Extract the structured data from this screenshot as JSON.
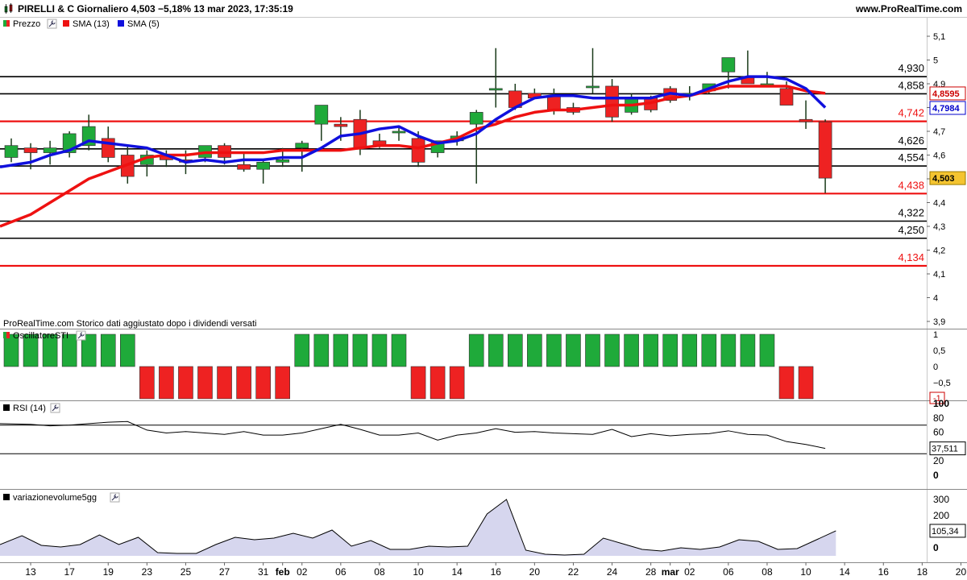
{
  "header": {
    "title": "PIRELLI & C Giornaliero 4,503  −5,18% 13 mar 2023, 17:35:19",
    "watermark": "www.ProRealTime.com"
  },
  "legend": {
    "price": "Prezzo",
    "sma13": "SMA (13)",
    "sma5": "SMA (5)",
    "osc": "OscillatoreSTI",
    "rsi": "RSI (14)",
    "vol": "variazionevolume5gg"
  },
  "note": "ProRealTime.com  Storico dati aggiustato dopo i dividendi versati",
  "colors": {
    "up": "#1faa3a",
    "down": "#ee2222",
    "sma13": "#ee1111",
    "sma5": "#1010dd",
    "level_black": "#000000",
    "level_red": "#ee1111",
    "vol_fill": "#d6d6ee",
    "last_price_bg": "#f4c430"
  },
  "chart_data": [
    {
      "type": "candlestick",
      "panel": "price",
      "y_ticks": [
        "5,1",
        "5",
        "4,9",
        "4,8",
        "4,7",
        "4,6",
        "4,5",
        "4,4",
        "4,3",
        "4,2",
        "4,1",
        "4",
        "3,9"
      ],
      "ylim": [
        3.9,
        5.15
      ],
      "x_tick_labels": [
        {
          "i": 1,
          "t": "13"
        },
        {
          "i": 3,
          "t": "17"
        },
        {
          "i": 5,
          "t": "19"
        },
        {
          "i": 7,
          "t": "23"
        },
        {
          "i": 9,
          "t": "25"
        },
        {
          "i": 11,
          "t": "27"
        },
        {
          "i": 13,
          "t": "31"
        },
        {
          "i": 14,
          "t": "feb"
        },
        {
          "i": 15,
          "t": "02"
        },
        {
          "i": 17,
          "t": "06"
        },
        {
          "i": 19,
          "t": "08"
        },
        {
          "i": 21,
          "t": "10"
        },
        {
          "i": 23,
          "t": "14"
        },
        {
          "i": 25,
          "t": "16"
        },
        {
          "i": 27,
          "t": "20"
        },
        {
          "i": 29,
          "t": "22"
        },
        {
          "i": 31,
          "t": "24"
        },
        {
          "i": 33,
          "t": "28"
        },
        {
          "i": 34,
          "t": "mar"
        },
        {
          "i": 35,
          "t": "02"
        },
        {
          "i": 37,
          "t": "06"
        },
        {
          "i": 39,
          "t": "08"
        },
        {
          "i": 41,
          "t": "10"
        },
        {
          "i": 43,
          "t": "14"
        },
        {
          "i": 45,
          "t": "16"
        },
        {
          "i": 47,
          "t": "18"
        },
        {
          "i": 49,
          "t": "20"
        }
      ],
      "candles": [
        {
          "o": 4.59,
          "h": 4.67,
          "l": 4.57,
          "c": 4.64
        },
        {
          "o": 4.63,
          "h": 4.65,
          "l": 4.54,
          "c": 4.61
        },
        {
          "o": 4.61,
          "h": 4.66,
          "l": 4.56,
          "c": 4.63
        },
        {
          "o": 4.61,
          "h": 4.7,
          "l": 4.59,
          "c": 4.69
        },
        {
          "o": 4.64,
          "h": 4.77,
          "l": 4.62,
          "c": 4.72
        },
        {
          "o": 4.67,
          "h": 4.72,
          "l": 4.57,
          "c": 4.59
        },
        {
          "o": 4.6,
          "h": 4.64,
          "l": 4.48,
          "c": 4.51
        },
        {
          "o": 4.56,
          "h": 4.62,
          "l": 4.51,
          "c": 4.6
        },
        {
          "o": 4.6,
          "h": 4.62,
          "l": 4.55,
          "c": 4.58
        },
        {
          "o": 4.58,
          "h": 4.62,
          "l": 4.52,
          "c": 4.57
        },
        {
          "o": 4.59,
          "h": 4.64,
          "l": 4.57,
          "c": 4.64
        },
        {
          "o": 4.64,
          "h": 4.65,
          "l": 4.56,
          "c": 4.59
        },
        {
          "o": 4.56,
          "h": 4.61,
          "l": 4.53,
          "c": 4.54
        },
        {
          "o": 4.54,
          "h": 4.58,
          "l": 4.48,
          "c": 4.57
        },
        {
          "o": 4.57,
          "h": 4.63,
          "l": 4.55,
          "c": 4.58
        },
        {
          "o": 4.63,
          "h": 4.66,
          "l": 4.53,
          "c": 4.65
        },
        {
          "o": 4.73,
          "h": 4.81,
          "l": 4.66,
          "c": 4.81
        },
        {
          "o": 4.73,
          "h": 4.76,
          "l": 4.66,
          "c": 4.72
        },
        {
          "o": 4.75,
          "h": 4.79,
          "l": 4.6,
          "c": 4.63
        },
        {
          "o": 4.66,
          "h": 4.69,
          "l": 4.63,
          "c": 4.64
        },
        {
          "o": 4.7,
          "h": 4.72,
          "l": 4.66,
          "c": 4.7
        },
        {
          "o": 4.67,
          "h": 4.7,
          "l": 4.55,
          "c": 4.57
        },
        {
          "o": 4.61,
          "h": 4.65,
          "l": 4.59,
          "c": 4.66
        },
        {
          "o": 4.66,
          "h": 4.7,
          "l": 4.64,
          "c": 4.68
        },
        {
          "o": 4.73,
          "h": 4.79,
          "l": 4.48,
          "c": 4.78
        },
        {
          "o": 4.88,
          "h": 5.05,
          "l": 4.8,
          "c": 4.88
        },
        {
          "o": 4.87,
          "h": 4.9,
          "l": 4.79,
          "c": 4.8
        },
        {
          "o": 4.86,
          "h": 4.88,
          "l": 4.84,
          "c": 4.84
        },
        {
          "o": 4.85,
          "h": 4.88,
          "l": 4.77,
          "c": 4.79
        },
        {
          "o": 4.8,
          "h": 4.82,
          "l": 4.77,
          "c": 4.78
        },
        {
          "o": 4.89,
          "h": 5.05,
          "l": 4.86,
          "c": 4.89
        },
        {
          "o": 4.89,
          "h": 4.92,
          "l": 4.74,
          "c": 4.76
        },
        {
          "o": 4.78,
          "h": 4.86,
          "l": 4.77,
          "c": 4.84
        },
        {
          "o": 4.84,
          "h": 4.85,
          "l": 4.78,
          "c": 4.79
        },
        {
          "o": 4.88,
          "h": 4.89,
          "l": 4.82,
          "c": 4.83
        },
        {
          "o": 4.86,
          "h": 4.89,
          "l": 4.83,
          "c": 4.86
        },
        {
          "o": 4.87,
          "h": 4.9,
          "l": 4.86,
          "c": 4.9
        },
        {
          "o": 4.95,
          "h": 5.01,
          "l": 4.88,
          "c": 5.01
        },
        {
          "o": 4.93,
          "h": 5.04,
          "l": 4.91,
          "c": 4.9
        },
        {
          "o": 4.9,
          "h": 4.95,
          "l": 4.89,
          "c": 4.9
        },
        {
          "o": 4.88,
          "h": 4.91,
          "l": 4.81,
          "c": 4.81
        },
        {
          "o": 4.75,
          "h": 4.83,
          "l": 4.71,
          "c": 4.74
        },
        {
          "o": 4.74,
          "h": 4.75,
          "l": 4.44,
          "c": 4.503
        }
      ],
      "sma13": [
        4.3,
        4.35,
        4.4,
        4.45,
        4.5,
        4.53,
        4.56,
        4.59,
        4.6,
        4.6,
        4.61,
        4.61,
        4.61,
        4.61,
        4.62,
        4.62,
        4.62,
        4.62,
        4.63,
        4.64,
        4.64,
        4.63,
        4.65,
        4.67,
        4.71,
        4.73,
        4.76,
        4.78,
        4.79,
        4.79,
        4.8,
        4.81,
        4.81,
        4.82,
        4.84,
        4.85,
        4.87,
        4.89,
        4.89,
        4.89,
        4.89,
        4.87,
        4.86
      ],
      "sma5": [
        4.55,
        4.57,
        4.6,
        4.62,
        4.66,
        4.65,
        4.64,
        4.63,
        4.6,
        4.57,
        4.58,
        4.57,
        4.58,
        4.58,
        4.59,
        4.59,
        4.63,
        4.68,
        4.69,
        4.71,
        4.72,
        4.68,
        4.65,
        4.66,
        4.69,
        4.75,
        4.8,
        4.84,
        4.85,
        4.85,
        4.84,
        4.84,
        4.84,
        4.84,
        4.86,
        4.85,
        4.88,
        4.91,
        4.93,
        4.93,
        4.92,
        4.88,
        4.8
      ],
      "sma13_last": "4,8595",
      "sma5_last": "4,7984",
      "last_price": "4,503",
      "levels": [
        {
          "value": 4.93,
          "label": "4,930",
          "color": "black"
        },
        {
          "value": 4.858,
          "label": "4,858",
          "color": "black"
        },
        {
          "value": 4.742,
          "label": "4,742",
          "color": "red"
        },
        {
          "value": 4.626,
          "label": "4,626",
          "color": "black"
        },
        {
          "value": 4.554,
          "label": "4,554",
          "color": "black"
        },
        {
          "value": 4.438,
          "label": "4,438",
          "color": "red"
        },
        {
          "value": 4.322,
          "label": "4,322",
          "color": "black"
        },
        {
          "value": 4.25,
          "label": "4,250",
          "color": "black"
        },
        {
          "value": 4.134,
          "label": "4,134",
          "color": "red"
        }
      ]
    },
    {
      "type": "bar",
      "panel": "OscillatoreSTI",
      "y_ticks": [
        "1",
        "0,5",
        "0",
        "−0,5"
      ],
      "last_label": "-1",
      "ylim": [
        -1.1,
        1.2
      ],
      "values": [
        1,
        1,
        1,
        1,
        1,
        1,
        1,
        -1,
        -1,
        -1,
        -1,
        -1,
        -1,
        -1,
        -1,
        1,
        1,
        1,
        1,
        1,
        1,
        -1,
        -1,
        -1,
        1,
        1,
        1,
        1,
        1,
        1,
        1,
        1,
        1,
        1,
        1,
        1,
        1,
        1,
        1,
        1,
        -1,
        -1
      ]
    },
    {
      "type": "line",
      "panel": "RSI (14)",
      "y_ticks": [
        "100",
        "80",
        "60",
        "40",
        "20",
        "0"
      ],
      "ylim": [
        0,
        100
      ],
      "reference": 70,
      "last_label": "37,511",
      "values": [
        72,
        71,
        69,
        70,
        72,
        74,
        75,
        63,
        59,
        61,
        59,
        57,
        61,
        56,
        56,
        59,
        65,
        71,
        64,
        56,
        56,
        59,
        49,
        56,
        59,
        65,
        60,
        61,
        59,
        58,
        57,
        64,
        54,
        58,
        55,
        57,
        58,
        62,
        57,
        56,
        47,
        43,
        37.511
      ]
    },
    {
      "type": "area",
      "panel": "variazionevolume5gg",
      "y_ticks": [
        "300",
        "200",
        "100",
        "0"
      ],
      "ylim": [
        -50,
        320
      ],
      "last_label": "105,34",
      "values": [
        20,
        75,
        15,
        5,
        20,
        80,
        20,
        65,
        -30,
        -35,
        -35,
        20,
        65,
        50,
        60,
        90,
        60,
        110,
        10,
        45,
        -10,
        -10,
        10,
        5,
        10,
        210,
        300,
        -15,
        -40,
        -45,
        -40,
        60,
        25,
        -10,
        -20,
        0,
        -10,
        5,
        50,
        40,
        -10,
        -5,
        50,
        105.34
      ]
    }
  ]
}
